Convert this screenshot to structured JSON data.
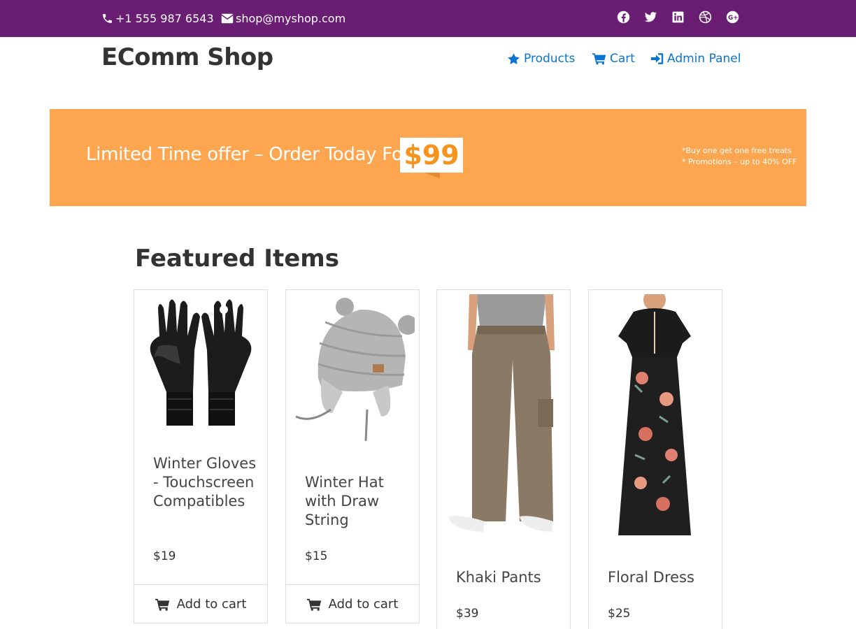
{
  "topbar": {
    "phone": "+1 555 987 6543",
    "email": "shop@myshop.com",
    "socials": [
      "facebook-icon",
      "twitter-icon",
      "linkedin-icon",
      "dribbble-icon",
      "google-plus-icon"
    ]
  },
  "header": {
    "brand": "EComm Shop",
    "nav": [
      {
        "label": "Products",
        "icon": "star-icon"
      },
      {
        "label": "Cart",
        "icon": "cart-icon"
      },
      {
        "label": "Admin Panel",
        "icon": "sign-in-icon"
      }
    ]
  },
  "banner": {
    "text": "Limited Time offer – Order Today For",
    "price": "$99",
    "promo_1": "*Buy one get one free treats",
    "promo_2": "* Promotions – up to 40% OFF"
  },
  "featured": {
    "title": "Featured Items",
    "items": [
      {
        "name": "Winter Gloves - Touchscreen Compatibles",
        "price": "$19",
        "action": "Add to cart"
      },
      {
        "name": "Winter Hat with Draw String",
        "price": "$15",
        "action": "Add to cart"
      },
      {
        "name": "Khaki Pants",
        "price": "$39"
      },
      {
        "name": "Floral Dress",
        "price": "$25"
      }
    ]
  },
  "colors": {
    "topbar": "#6a1e73",
    "link": "#0a74cf",
    "banner": "#fea54f",
    "banner_price": "#f7941d"
  }
}
